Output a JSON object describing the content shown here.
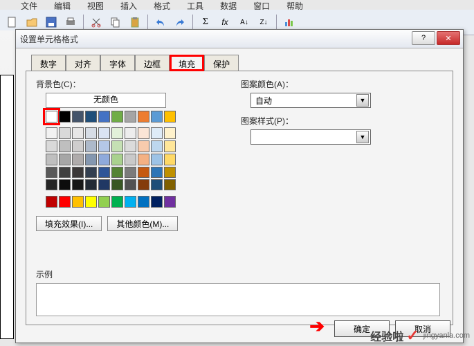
{
  "menu": [
    "文件",
    "编辑",
    "视图",
    "插入",
    "格式",
    "工具",
    "数据",
    "窗口",
    "帮助"
  ],
  "dialog": {
    "title": "设置单元格格式",
    "tabs": [
      "数字",
      "对齐",
      "字体",
      "边框",
      "填充",
      "保护"
    ],
    "active_tab": "填充",
    "bg_label": "背景色(C)：",
    "no_color": "无颜色",
    "fill_effects": "填充效果(I)...",
    "more_colors": "其他颜色(M)...",
    "pattern_color_label": "图案颜色(A)：",
    "pattern_color_value": "自动",
    "pattern_style_label": "图案样式(P)：",
    "example_label": "示例",
    "ok": "确定",
    "cancel": "取消"
  },
  "colors": {
    "row1": [
      "#ffffff",
      "#000000",
      "#44546a",
      "#1f4e79",
      "#4472c4",
      "#70ad47",
      "#a5a5a5",
      "#ed7d31",
      "#5b9bd5",
      "#ffc000"
    ],
    "row2": [
      "#f2f2f2",
      "#d9d9d9",
      "#e7e6e6",
      "#d6dce5",
      "#dae3f3",
      "#e2f0d9",
      "#ededed",
      "#fbe5d6",
      "#deebf7",
      "#fff2cc"
    ],
    "row3": [
      "#d9d9d9",
      "#bfbfbf",
      "#cfcdcd",
      "#adb9ca",
      "#b4c7e7",
      "#c5e0b4",
      "#dbdbdb",
      "#f8cbad",
      "#bdd7ee",
      "#ffe699"
    ],
    "row4": [
      "#bfbfbf",
      "#a6a6a6",
      "#afabab",
      "#8497b0",
      "#8faadc",
      "#a9d18e",
      "#c9c9c9",
      "#f4b183",
      "#9dc3e6",
      "#ffd966"
    ],
    "row5": [
      "#595959",
      "#404040",
      "#3b3838",
      "#333f50",
      "#2f5597",
      "#548235",
      "#7b7b7b",
      "#c55a11",
      "#2e75b6",
      "#bf9000"
    ],
    "row6": [
      "#262626",
      "#0d0d0d",
      "#171717",
      "#222a35",
      "#203864",
      "#385723",
      "#525252",
      "#843c0c",
      "#1f4e79",
      "#806000"
    ],
    "standard": [
      "#c00000",
      "#ff0000",
      "#ffc000",
      "#ffff00",
      "#92d050",
      "#00b050",
      "#00b0f0",
      "#0070c0",
      "#002060",
      "#7030a0"
    ]
  },
  "watermark": {
    "brand": "经验啦",
    "url": "jingyanla.com"
  }
}
